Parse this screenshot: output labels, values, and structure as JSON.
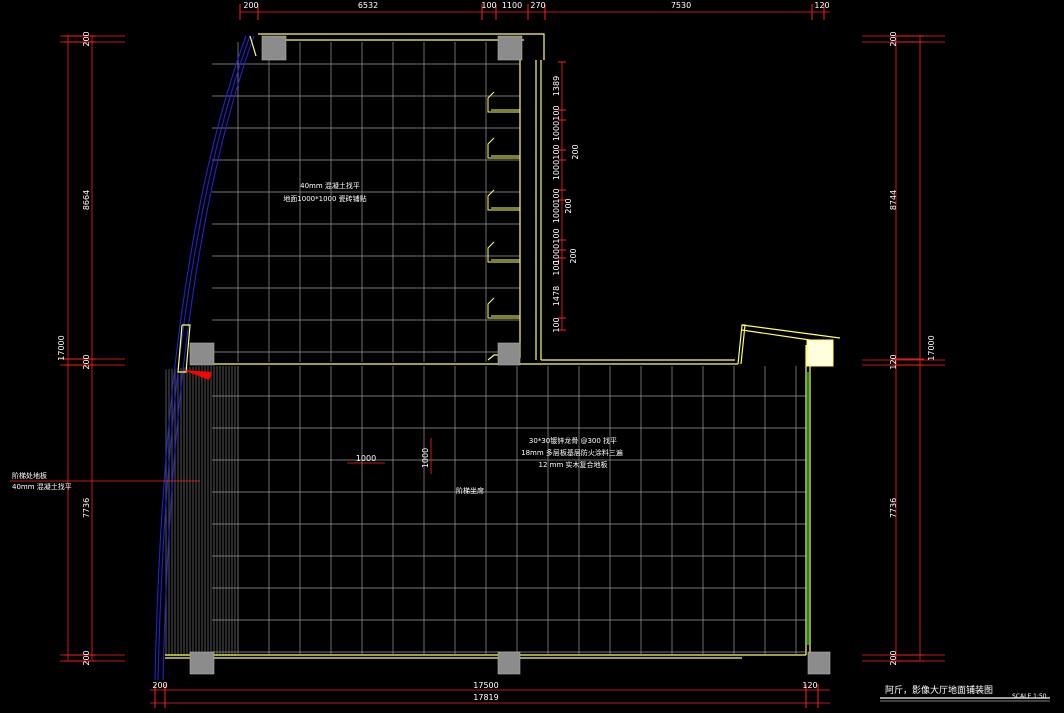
{
  "colors": {
    "background": "#000000",
    "wall": "#ffff66",
    "grid": "#9a9a9a",
    "dimension": "#ff2020",
    "curtain_wall": "#2222cc",
    "column": "#8c8c8c",
    "glass": "#22cc22",
    "text": "#ffffff"
  },
  "dimensions": {
    "top": [
      "200",
      "6532",
      "100",
      "1100",
      "270",
      "7530",
      "120"
    ],
    "left_outer": "17000",
    "left_inner": [
      "200",
      "8664",
      "200",
      "7736",
      "200"
    ],
    "right_outer": "17000",
    "right_inner": [
      "200",
      "8744",
      "120",
      "7736",
      "200"
    ],
    "bottom_inner": [
      "200",
      "17500",
      "120"
    ],
    "bottom_total": "17819",
    "partition_column": [
      "1389",
      "100",
      "1000",
      "100",
      "1000",
      "100",
      "1000",
      "100",
      "1000",
      "100",
      "1478",
      "100"
    ],
    "partition_offsets": [
      "200",
      "200",
      "200"
    ],
    "grid_module_horizontal": "1000",
    "grid_module_vertical": "1000"
  },
  "notes": {
    "upper_floor": [
      "40mm 混凝土找平",
      "地面1000*1000 瓷砖铺贴"
    ],
    "lower_floor": [
      "30*30镀锌龙骨 @300 找平",
      "18mm 多层板基层防火涂料三遍",
      "12 mm 实木复合地板"
    ],
    "center": "阶梯坐席",
    "left_callout": [
      "阶梯处地板",
      "40mm 混凝土找平"
    ]
  },
  "title_block": {
    "title": "阿斤，影像大厅地面铺装图",
    "scale": "SCALE 1:50"
  }
}
